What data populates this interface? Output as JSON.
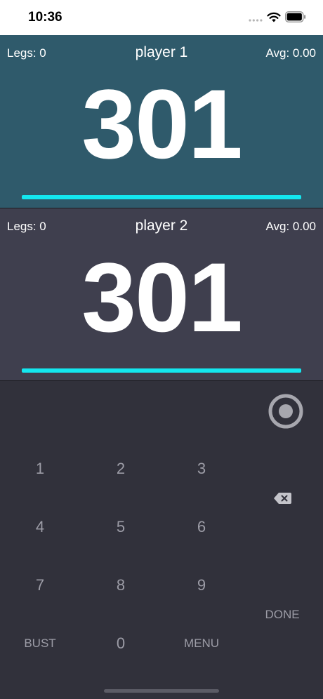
{
  "status_bar": {
    "time": "10:36",
    "icons": [
      "signal-icon",
      "wifi-icon",
      "battery-icon"
    ]
  },
  "players": [
    {
      "name": "player 1",
      "legs": "Legs: 0",
      "avg": "Avg: 0.00",
      "score": "301",
      "progress": 1.0,
      "background": "#2f5a6b"
    },
    {
      "name": "player 2",
      "legs": "Legs: 0",
      "avg": "Avg: 0.00",
      "score": "301",
      "progress": 1.0,
      "background": "#3f3f4e"
    }
  ],
  "keypad": {
    "keys": [
      "1",
      "2",
      "3",
      "4",
      "5",
      "6",
      "7",
      "8",
      "9",
      "BUST",
      "0",
      "MENU"
    ],
    "done": "DONE",
    "target_icon": "target-icon",
    "backspace_icon": "backspace-icon"
  },
  "colors": {
    "accent": "#13e7ef",
    "keypad_bg": "#31313b",
    "key_text": "#9c9ca6"
  }
}
